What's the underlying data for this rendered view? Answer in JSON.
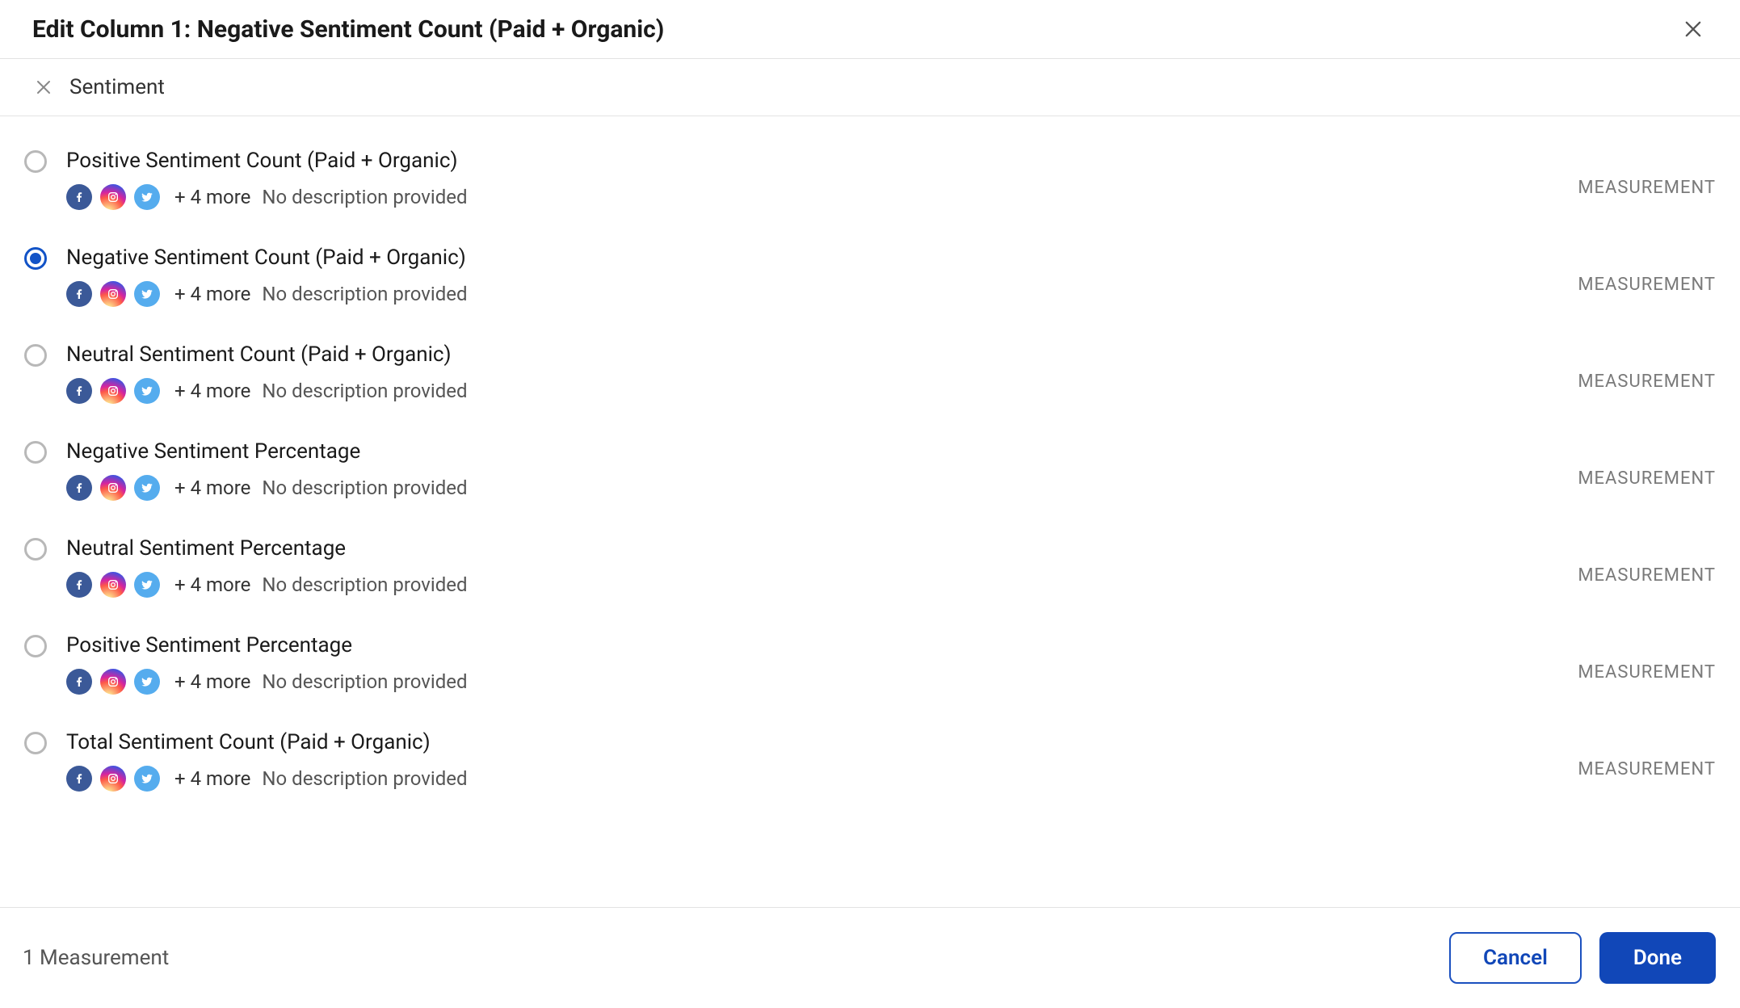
{
  "header": {
    "title": "Edit Column 1: Negative Sentiment Count (Paid + Organic)"
  },
  "filter": {
    "chip_label": "Sentiment"
  },
  "list_meta": {
    "more_label": "+ 4 more",
    "desc_label": "No description provided",
    "badge_label": "MEASUREMENT"
  },
  "options": [
    {
      "title": "Positive Sentiment Count (Paid + Organic)",
      "selected": false
    },
    {
      "title": "Negative Sentiment Count (Paid + Organic)",
      "selected": true
    },
    {
      "title": "Neutral Sentiment Count (Paid + Organic)",
      "selected": false
    },
    {
      "title": "Negative Sentiment Percentage",
      "selected": false
    },
    {
      "title": "Neutral Sentiment Percentage",
      "selected": false
    },
    {
      "title": "Positive Sentiment Percentage",
      "selected": false
    },
    {
      "title": "Total Sentiment Count (Paid + Organic)",
      "selected": false
    }
  ],
  "footer": {
    "count_label": "1 Measurement",
    "cancel_label": "Cancel",
    "done_label": "Done"
  }
}
